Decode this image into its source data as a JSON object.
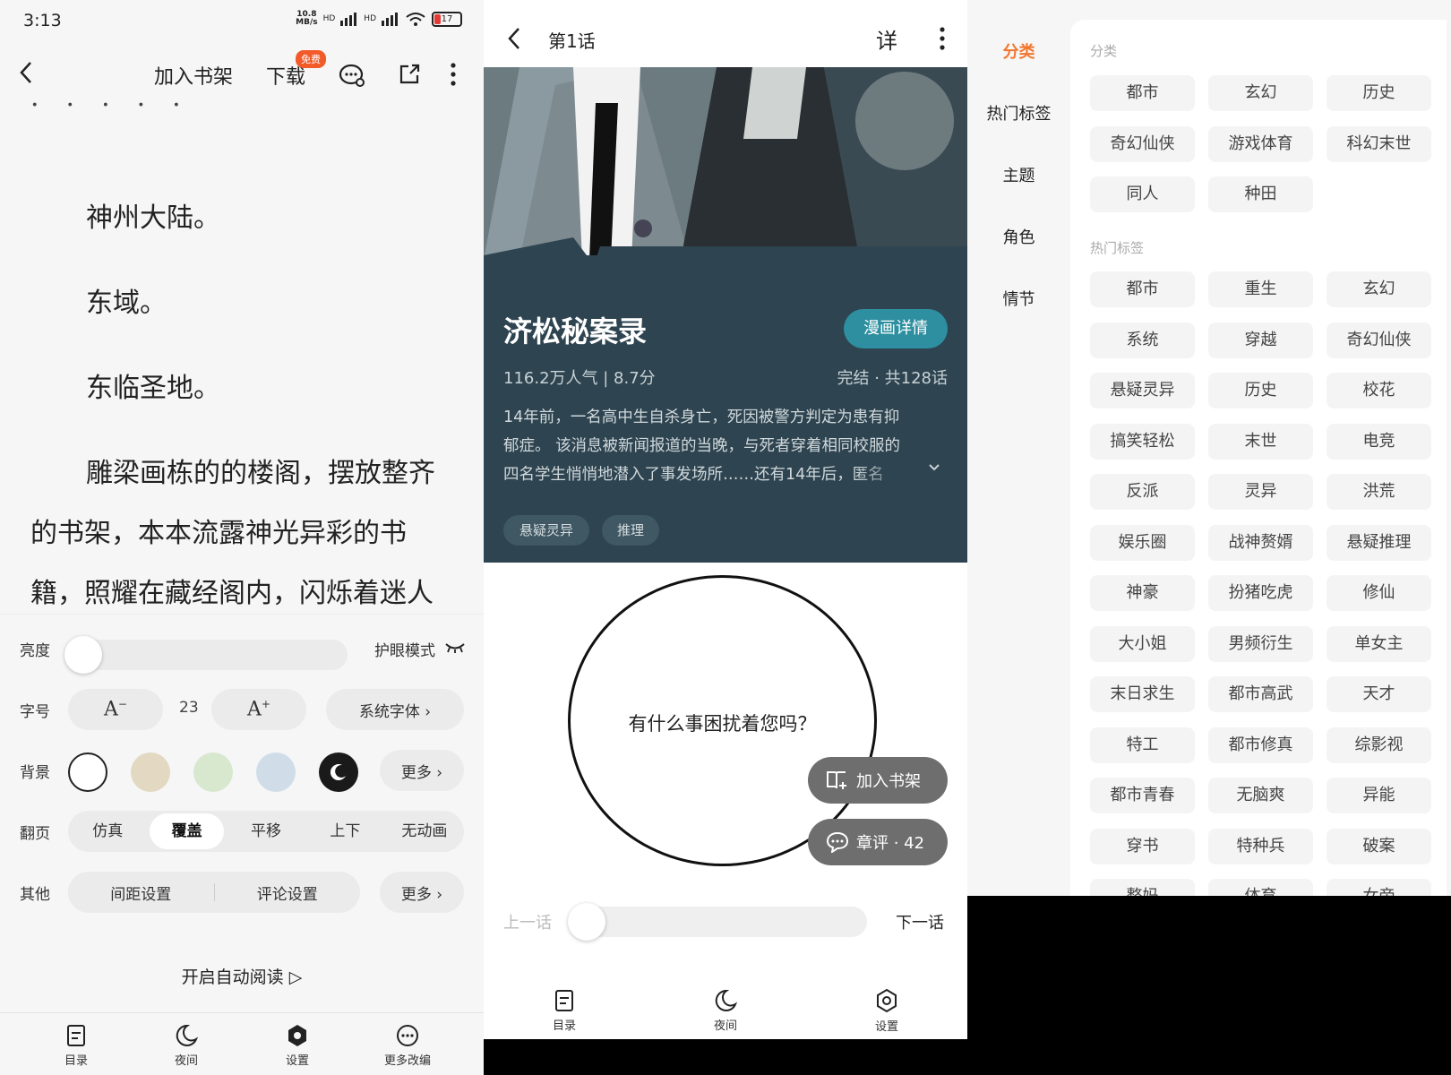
{
  "reader": {
    "status": {
      "time": "3:13",
      "net_speed": "10.8",
      "net_unit": "MB/s",
      "hd1": "HD",
      "hd2": "HD",
      "battery": "17"
    },
    "toolbar": {
      "add_shelf": "加入书架",
      "download": "下载",
      "free_badge": "免费"
    },
    "text_lines": [
      "神州大陆。",
      "东域。",
      "东临圣地。",
      "雕梁画栋的的楼阁，摆放整齐",
      "的书架，本本流露神光异彩的书",
      "籍，照耀在藏经阁内，闪烁着迷人"
    ],
    "settings": {
      "brightness_label": "亮度",
      "eye_mode": "护眼模式",
      "fontsize_label": "字号",
      "font_size": "23",
      "font_face": "系统字体 ›",
      "bg_label": "背景",
      "bg_more": "更多 ›",
      "bg_colors": [
        "#ffffff",
        "#e3d9c2",
        "#d8e8cf",
        "#d0dde9",
        "#1a1a1a"
      ],
      "page_label": "翻页",
      "page_modes": [
        "仿真",
        "覆盖",
        "平移",
        "上下",
        "无动画"
      ],
      "page_mode_selected": "覆盖",
      "other_label": "其他",
      "spacing": "间距设置",
      "comment": "评论设置",
      "other_more": "更多 ›",
      "auto_read": "开启自动阅读 ▷"
    },
    "nav": {
      "toc": "目录",
      "night": "夜间",
      "settings": "设置",
      "more": "更多改编"
    }
  },
  "comic": {
    "chapter_title": "第1话",
    "detail_char": "详",
    "title": "济松秘案录",
    "detail_btn": "漫画详情",
    "popularity": "116.2万人气 | 8.7分",
    "status": "完结 · 共128话",
    "desc_lines": [
      "14年前，一名高中生自杀身亡，死因被警方判定为患有抑",
      "郁症。 该消息被新闻报道的当晚，与死者穿着相同校服的",
      "四名学生悄悄地潜入了事发场所……还有14年后，匿名"
    ],
    "tags": [
      "悬疑灵异",
      "推理"
    ],
    "bubble_text": "有什么事困扰着您吗？",
    "add_shelf": "加入书架",
    "chapter_comment": "章评 · 42",
    "prev": "上一话",
    "next": "下一话",
    "nav": {
      "toc": "目录",
      "night": "夜间",
      "settings": "设置"
    }
  },
  "category": {
    "side_items": [
      "分类",
      "热门标签",
      "主题",
      "角色",
      "情节"
    ],
    "side_selected": "分类",
    "section1_title": "分类",
    "section1_chips": [
      "都市",
      "玄幻",
      "历史",
      "奇幻仙侠",
      "游戏体育",
      "科幻末世",
      "同人",
      "种田"
    ],
    "section2_title": "热门标签",
    "section2_chips": [
      "都市",
      "重生",
      "玄幻",
      "系统",
      "穿越",
      "奇幻仙侠",
      "悬疑灵异",
      "历史",
      "校花",
      "搞笑轻松",
      "末世",
      "电竞",
      "反派",
      "灵异",
      "洪荒",
      "娱乐圈",
      "战神赘婿",
      "悬疑推理",
      "神豪",
      "扮猪吃虎",
      "修仙",
      "大小姐",
      "男频衍生",
      "单女主",
      "末日求生",
      "都市高武",
      "天才",
      "特工",
      "都市修真",
      "综影视",
      "都市青春",
      "无脑爽",
      "异能",
      "穿书",
      "特种兵",
      "破案",
      "整妈",
      "体育",
      "女帝"
    ]
  },
  "colors": {
    "accent": "#f2762e",
    "comic_info_bg": "#2e4450",
    "detail_btn": "#2d8fa0"
  }
}
